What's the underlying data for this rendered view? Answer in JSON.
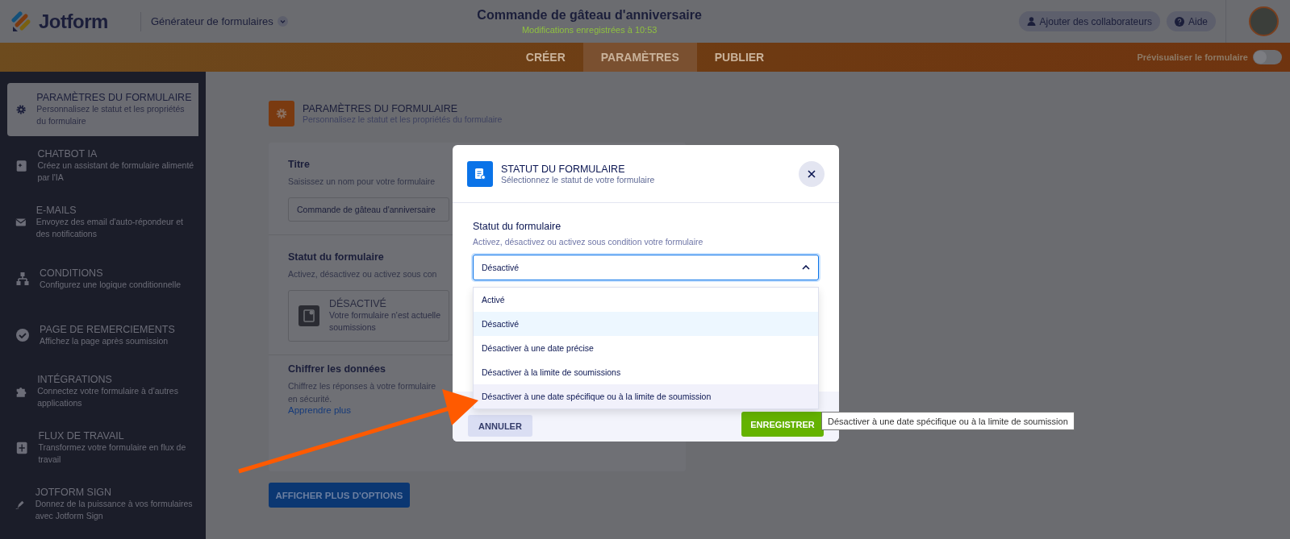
{
  "header": {
    "logo_text": "Jotform",
    "app_menu": "Générateur de formulaires",
    "title": "Commande de gâteau d'anniversaire",
    "saved_status": "Modifications enregistrées à 10:53",
    "collaborators_button": "Ajouter des collaborateurs",
    "help_button": "Aide"
  },
  "nav_tabs": [
    {
      "label": "CRÉER",
      "selected": false
    },
    {
      "label": "PARAMÈTRES",
      "selected": true
    },
    {
      "label": "PUBLIER",
      "selected": false
    }
  ],
  "preview_toggle": {
    "label": "Prévisualiser le formulaire",
    "on": false
  },
  "sidebar": {
    "items": [
      {
        "title": "PARAMÈTRES DU FORMULAIRE",
        "description": "Personnalisez le statut et les propriétés du formulaire",
        "selected": true
      },
      {
        "title": "CHATBOT IA",
        "description": "Créez un assistant de formulaire alimenté par l'IA",
        "selected": false
      },
      {
        "title": "E-MAILS",
        "description": "Envoyez des email d'auto-répondeur et des notifications",
        "selected": false
      },
      {
        "title": "CONDITIONS",
        "description": "Configurez une logique conditionnelle",
        "selected": false
      },
      {
        "title": "PAGE DE REMERCIEMENTS",
        "description": "Affichez la page après soumission",
        "selected": false
      },
      {
        "title": "INTÉGRATIONS",
        "description": "Connectez votre formulaire à d'autres applications",
        "selected": false
      },
      {
        "title": "FLUX DE TRAVAIL",
        "description": "Transformez votre formulaire en flux de travail",
        "selected": false
      },
      {
        "title": "JOTFORM SIGN",
        "description": "Donnez de la puissance à vos formulaires avec Jotform Sign",
        "selected": false
      }
    ]
  },
  "page": {
    "title": "PARAMÈTRES DU FORMULAIRE",
    "subtitle": "Personnalisez le statut et les propriétés du formulaire",
    "title_section": {
      "title": "Titre",
      "description": "Saisissez un nom pour votre formulaire",
      "value": "Commande de gâteau d'anniversaire"
    },
    "status_section": {
      "title": "Statut du formulaire",
      "description": "Activez, désactivez ou activez sous con",
      "card_title": "DÉSACTIVÉ",
      "card_lines": [
        "Votre formulaire n'est actuelle",
        "soumissions"
      ]
    },
    "encrypt_section": {
      "title": "Chiffrer les données",
      "lines": [
        "Chiffrez les réponses à votre formulaire",
        "en sécurité."
      ],
      "link": "Apprendre plus"
    },
    "more_button": "AFFICHER PLUS D'OPTIONS"
  },
  "modal": {
    "title": "STATUT DU FORMULAIRE",
    "subtitle": "Sélectionnez le statut de votre formulaire",
    "field_label": "Statut du formulaire",
    "field_description": "Activez, désactivez ou activez sous condition votre formulaire",
    "select": {
      "value": "Désactivé",
      "expanded": true
    },
    "options": [
      {
        "label": "Activé",
        "selected": false,
        "hovered": false
      },
      {
        "label": "Désactivé",
        "selected": true,
        "hovered": false
      },
      {
        "label": "Désactiver à une date précise",
        "selected": false,
        "hovered": false
      },
      {
        "label": "Désactiver à la limite de soumissions",
        "selected": false,
        "hovered": false
      },
      {
        "label": "Désactiver à une date spécifique ou à la limite de soumission",
        "selected": false,
        "hovered": true
      }
    ],
    "cancel_button": "ANNULER",
    "save_button": "ENREGISTRER"
  },
  "tooltip": "Désactiver à une date spécifique ou à la limite de soumission"
}
